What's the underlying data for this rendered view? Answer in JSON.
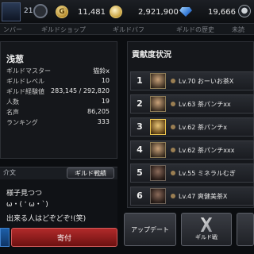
{
  "header": {
    "stamina": "21",
    "gold_icon": "G",
    "gold": "11,481",
    "silver": "2,921,900",
    "gems": "19,666"
  },
  "tabs": [
    "ンバー",
    "ギルドショップ",
    "ギルドバフ",
    "ギルドの歴史"
  ],
  "tabs_extra": "未読",
  "guild": {
    "name": "浅葱",
    "stats": [
      {
        "label": "ギルドマスター",
        "value": "猫鈴x"
      },
      {
        "label": "ギルドレベル",
        "value": "10"
      },
      {
        "label": "ギルド経験値",
        "value": "283,145 / 292,820"
      },
      {
        "label": "人数",
        "value": "19"
      },
      {
        "label": "名声",
        "value": "86,205"
      },
      {
        "label": "ランキング",
        "value": "333"
      }
    ]
  },
  "chat": {
    "tab": "介文",
    "guild_battle_button": "ギルド戦績",
    "lines": [
      "様子見つつ",
      "ω・( ' ω・`)",
      "出来る人はどぞどぞ!(笑)"
    ],
    "donate_button": "寄付"
  },
  "contribution": {
    "title": "貢献度状況",
    "rows": [
      {
        "rank": "1",
        "text": "Lv.70 おーいお茶X"
      },
      {
        "rank": "2",
        "text": "Lv.63 茶パンチxx"
      },
      {
        "rank": "3",
        "text": "Lv.62 茶パンチx"
      },
      {
        "rank": "4",
        "text": "Lv.62 茶パンチxxx"
      },
      {
        "rank": "5",
        "text": "Lv.55 ミネラルむぎ"
      },
      {
        "rank": "6",
        "text": "Lv.47 爽健美茶X"
      }
    ]
  },
  "buttons": {
    "update": "アップデート",
    "guild_battle": "ギルド戦"
  }
}
